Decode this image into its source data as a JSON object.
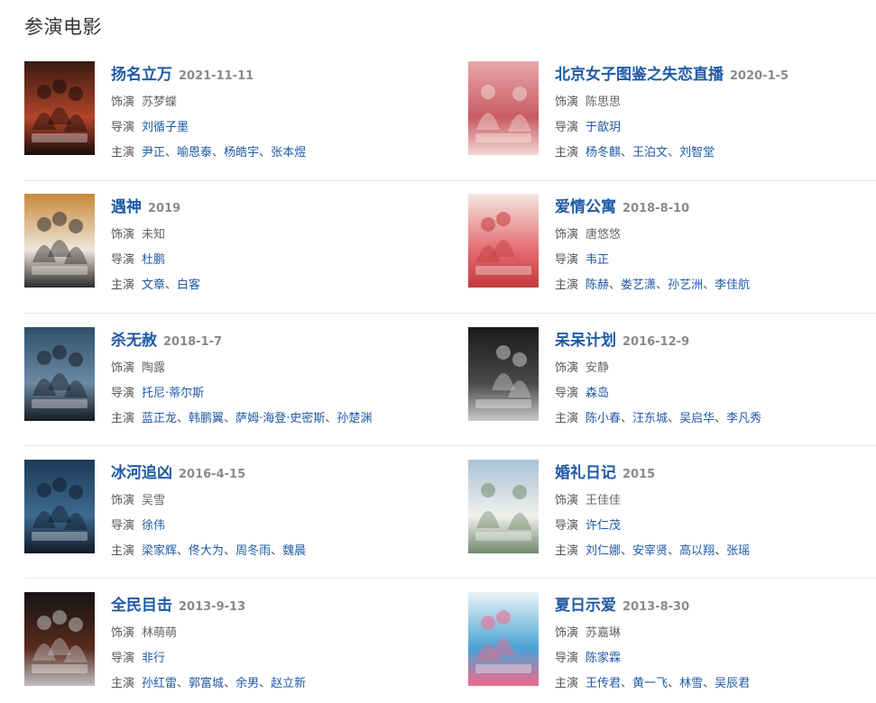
{
  "section": {
    "title": "参演电影"
  },
  "labels": {
    "role": "饰演",
    "director": "导演",
    "cast": "主演",
    "list_sep": "、"
  },
  "films": [
    {
      "title": "扬名立万",
      "date": "2021-11-11",
      "role": "苏梦蝶",
      "director": [
        "刘循子墨"
      ],
      "cast": [
        "尹正",
        "喻恩泰",
        "杨皓宇",
        "张本煜"
      ],
      "poster_colors": [
        "#3a1a12",
        "#b3452a",
        "#1a0d0a"
      ]
    },
    {
      "title": "北京女子图鉴之失恋直播",
      "date": "2020-1-5",
      "role": "陈思思",
      "director": [
        "于歆玥"
      ],
      "cast": [
        "杨冬麒",
        "王泊文",
        "刘智堂"
      ],
      "poster_colors": [
        "#e9a7a9",
        "#c75b63",
        "#f3d6d2"
      ]
    },
    {
      "title": "遇神",
      "date": "2019",
      "role": "未知",
      "director": [
        "杜鹏"
      ],
      "cast": [
        "文章",
        "白客"
      ],
      "poster_colors": [
        "#c9883a",
        "#efe6dc",
        "#2b2b2b"
      ]
    },
    {
      "title": "爱情公寓",
      "date": "2018-8-10",
      "role": "唐悠悠",
      "director": [
        "韦正"
      ],
      "cast": [
        "陈赫",
        "娄艺潇",
        "孙艺洲",
        "李佳航"
      ],
      "poster_colors": [
        "#f4e7de",
        "#e46b73",
        "#c23b3b"
      ]
    },
    {
      "title": "杀无赦",
      "date": "2018-1-7",
      "role": "陶露",
      "director": [
        "托尼·蒂尔斯"
      ],
      "cast": [
        "蓝正龙",
        "韩鹏翼",
        "萨姆·海登·史密斯",
        "孙楚渊"
      ],
      "poster_colors": [
        "#2f4f6b",
        "#6c8aa3",
        "#151b22"
      ]
    },
    {
      "title": "呆呆计划",
      "date": "2016-12-9",
      "role": "安静",
      "director": [
        "森岛"
      ],
      "cast": [
        "陈小春",
        "汪东城",
        "吴启华",
        "李凡秀"
      ],
      "poster_colors": [
        "#1a1a1a",
        "#4a4a4a",
        "#c9c9c9"
      ]
    },
    {
      "title": "冰河追凶",
      "date": "2016-4-15",
      "role": "吴雪",
      "director": [
        "徐伟"
      ],
      "cast": [
        "梁家辉",
        "佟大为",
        "周冬雨",
        "魏晨"
      ],
      "poster_colors": [
        "#1d3a57",
        "#3f6a8f",
        "#0e1b29"
      ]
    },
    {
      "title": "婚礼日记",
      "date": "2015",
      "role": "王佳佳",
      "director": [
        "许仁茂"
      ],
      "cast": [
        "刘仁娜",
        "安宰贤",
        "高以翔",
        "张瑶"
      ],
      "poster_colors": [
        "#a7c2d6",
        "#f2f0ee",
        "#6f8a6a"
      ]
    },
    {
      "title": "全民目击",
      "date": "2013-9-13",
      "role": "林萌萌",
      "director": [
        "非行"
      ],
      "cast": [
        "孙红雷",
        "郭富城",
        "余男",
        "赵立新"
      ],
      "poster_colors": [
        "#141414",
        "#5a2a1c",
        "#bfbfbf"
      ]
    },
    {
      "title": "夏日示爱",
      "date": "2013-8-30",
      "role": "苏嘉琳",
      "director": [
        "陈家霖"
      ],
      "cast": [
        "王传君",
        "黄一飞",
        "林雪",
        "吴辰君"
      ],
      "poster_colors": [
        "#e9f3f7",
        "#4aa3d6",
        "#f06a8a"
      ]
    }
  ]
}
